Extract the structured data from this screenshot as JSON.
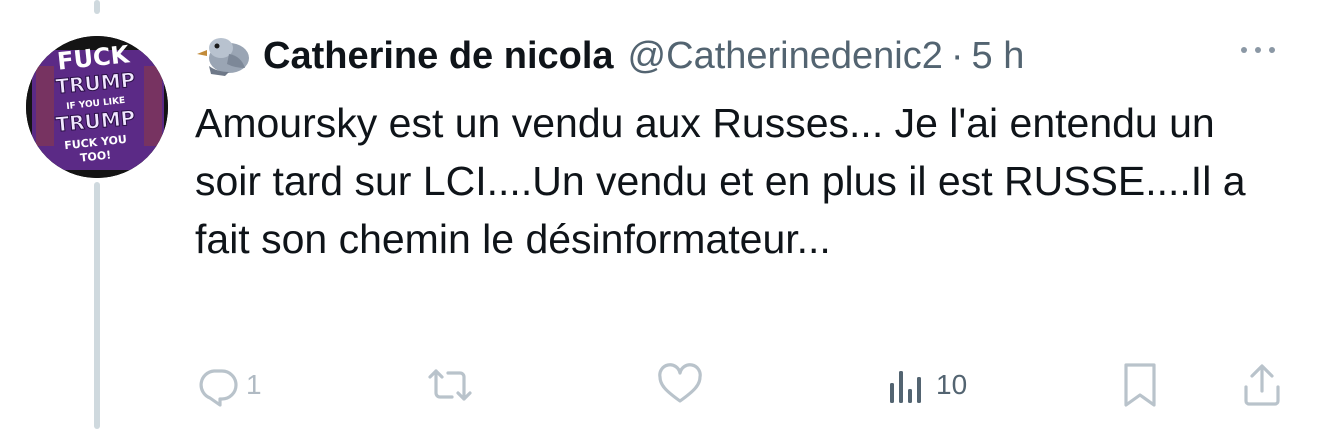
{
  "tweet": {
    "author": {
      "display_name": "Catherine de nicola",
      "handle": "@Catherinedenic2",
      "emoji_icon": "bird-icon",
      "avatar_text": [
        "FUCK",
        "TRUMP",
        "IF YOU LIKE",
        "TRUMP",
        "FUCK YOU",
        "TOO!"
      ]
    },
    "separator": "·",
    "time": "5 h",
    "text": "Amoursky est un vendu aux Russes... Je l'ai entendu un soir tard sur LCI....Un vendu et en plus il est RUSSE....Il a fait son chemin le désinformateur...",
    "actions": {
      "reply_count": "1",
      "retweet_count": "",
      "like_count": "",
      "views_count": "10"
    }
  },
  "colors": {
    "text": "#0f1419",
    "secondary": "#536471",
    "muted_icon": "#b9c3cb",
    "avatar_purple": "#5b2a86"
  }
}
